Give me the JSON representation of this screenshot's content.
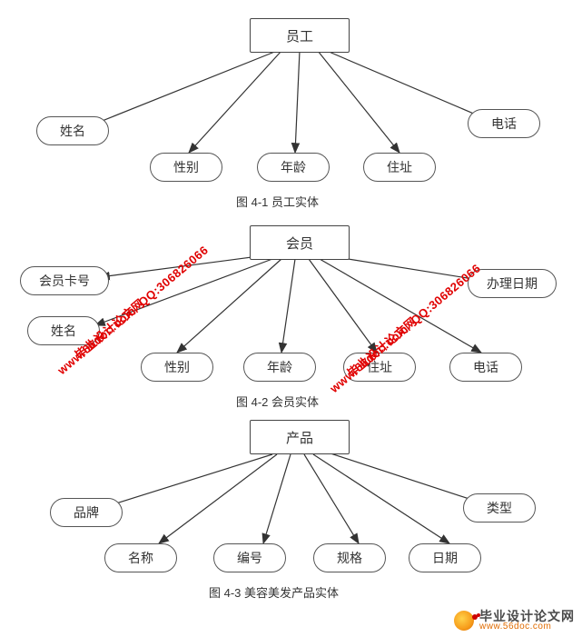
{
  "diagrams": [
    {
      "root": "员工",
      "attributes": [
        "姓名",
        "性别",
        "年龄",
        "住址",
        "电话"
      ],
      "caption": "图 4-1 员工实体"
    },
    {
      "root": "会员",
      "attributes": [
        "会员卡号",
        "姓名",
        "性别",
        "年龄",
        "住址",
        "电话",
        "办理日期"
      ],
      "caption": "图 4-2 会员实体"
    },
    {
      "root": "产品",
      "attributes": [
        "品牌",
        "名称",
        "编号",
        "规格",
        "日期",
        "类型"
      ],
      "caption": "图 4-3 美容美发产品实体"
    }
  ],
  "watermarks": {
    "url": "www.56doc.com",
    "qq": "QQ:306826066",
    "brand": "毕业设计论文网"
  },
  "footer": {
    "brand_cn": "毕业设计论文网",
    "brand_en": "www.56doc.com"
  }
}
